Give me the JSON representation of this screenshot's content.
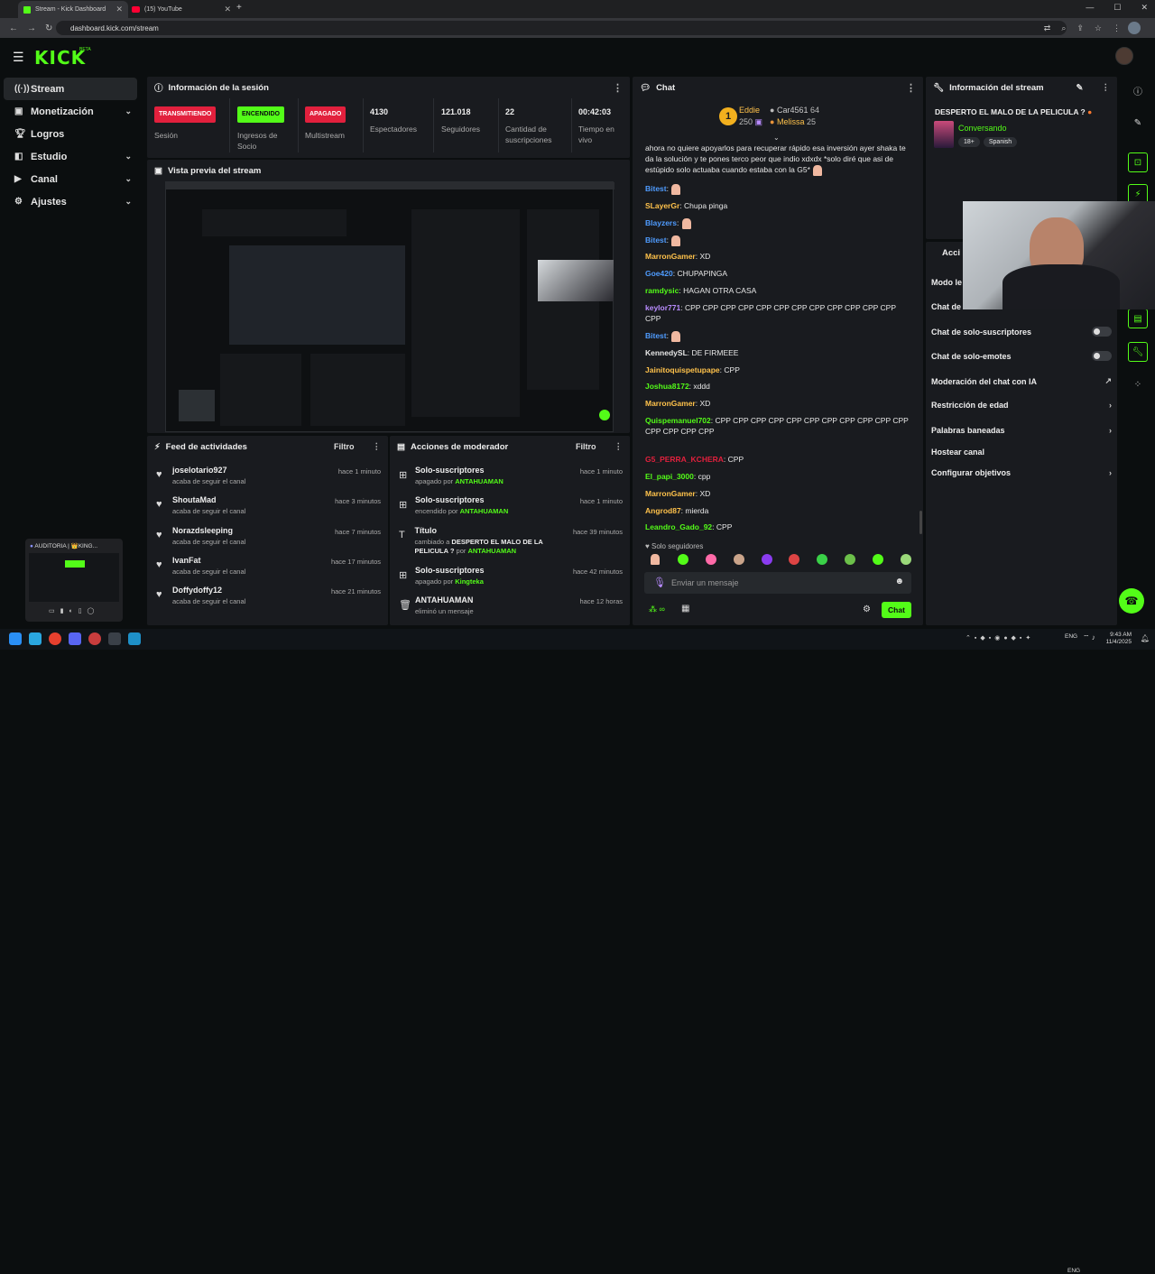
{
  "browser": {
    "tabs": [
      {
        "title": "Stream - Kick Dashboard",
        "active": true
      },
      {
        "title": "(15) YouTube",
        "active": false
      }
    ],
    "url": "dashboard.kick.com/stream"
  },
  "header": {
    "logo": "KICK",
    "beta": "BETA"
  },
  "sidebar": {
    "items": [
      {
        "label": "Stream",
        "icon": "stream-icon",
        "active": true,
        "chevron": false
      },
      {
        "label": "Monetización",
        "icon": "wallet-icon",
        "chevron": true
      },
      {
        "label": "Logros",
        "icon": "trophy-icon",
        "chevron": false
      },
      {
        "label": "Estudio",
        "icon": "studio-icon",
        "chevron": true
      },
      {
        "label": "Canal",
        "icon": "channel-icon",
        "chevron": true
      },
      {
        "label": "Ajustes",
        "icon": "gear-icon",
        "chevron": true
      }
    ]
  },
  "session": {
    "title": "Información de la sesión",
    "cols": [
      {
        "badge": "TRANSMITIENDO",
        "label": "Sesión",
        "kind": "red"
      },
      {
        "badge": "ENCENDIDO",
        "label": "Ingresos de Socio",
        "kind": "green"
      },
      {
        "badge": "APAGADO",
        "label": "Multistream",
        "kind": "red"
      },
      {
        "value": "4130",
        "label": "Espectadores"
      },
      {
        "value": "121.018",
        "label": "Seguidores"
      },
      {
        "value": "22",
        "label": "Cantidad de suscripciones"
      },
      {
        "value": "00:42:03",
        "label": "Tiempo en vivo"
      }
    ]
  },
  "preview": {
    "title": "Vista previa del stream"
  },
  "feed": {
    "title": "Feed de actividades",
    "filter": "Filtro",
    "items": [
      {
        "name": "joselotario927",
        "sub": "acaba de seguir el canal",
        "time": "hace 1 minuto"
      },
      {
        "name": "ShoutaMad",
        "sub": "acaba de seguir el canal",
        "time": "hace 3 minutos"
      },
      {
        "name": "Norazdsleeping",
        "sub": "acaba de seguir el canal",
        "time": "hace 7 minutos"
      },
      {
        "name": "IvanFat",
        "sub": "acaba de seguir el canal",
        "time": "hace 17 minutos"
      },
      {
        "name": "Doffydoffy12",
        "sub": "acaba de seguir el canal",
        "time": "hace 21 minutos"
      }
    ]
  },
  "mod": {
    "title": "Acciones de moderador",
    "filter": "Filtro",
    "items": [
      {
        "name": "Solo-suscriptores",
        "sub": "apagado por",
        "who": "ANTAHUAMAN",
        "time": "hace 1 minuto"
      },
      {
        "name": "Solo-suscriptores",
        "sub": "encendido por",
        "who": "ANTAHUAMAN",
        "time": "hace 1 minuto"
      },
      {
        "name": "Título",
        "sub": "cambiado a",
        "extra": "DESPERTO EL MALO DE LA PELICULA ?",
        "by": "por",
        "who": "ANTAHUAMAN",
        "time": "hace 39 minutos"
      },
      {
        "name": "Solo-suscriptores",
        "sub": "apagado por",
        "who": "Kingteka",
        "time": "hace 42 minutos"
      },
      {
        "name": "ANTAHUAMAN",
        "sub": "eliminó un mensaje",
        "time": "hace 12 horas"
      }
    ]
  },
  "chat": {
    "title": "Chat",
    "pinned": {
      "rank": "1",
      "first": "Eddie",
      "first_count": "250",
      "second": "Car4561",
      "second_count": "64",
      "third": "Melissa",
      "third_count": "25"
    },
    "messages": [
      {
        "user": "",
        "text": "ahora no quiere apoyarlos para recuperar rápido esa inversión ayer shaka te da la solución y te pones terco peor que indio xdxdx *solo diré que asi de estúpido solo actuaba cuando estaba con la G5*",
        "color": "#e8e8e8"
      },
      {
        "user": "Bitest",
        "text": "",
        "color": "#4f9cff"
      },
      {
        "user": "SLayerGr",
        "text": "Chupa pinga",
        "color": "#ffc24b"
      },
      {
        "user": "Blayzers",
        "text": "",
        "color": "#4f9cff"
      },
      {
        "user": "Bitest",
        "text": "",
        "color": "#4f9cff"
      },
      {
        "user": "MarronGamer",
        "text": "XD",
        "color": "#ffc24b"
      },
      {
        "user": "Goe420",
        "text": "CHUPAPINGA",
        "color": "#4f9cff"
      },
      {
        "user": "ramdysic",
        "text": "HAGAN OTRA CASA",
        "color": "#53fc18"
      },
      {
        "user": "keylor771",
        "text": "CPP  CPP  CPP  CPP  CPP  CPP  CPP  CPP  CPP  CPP  CPP  CPP  CPP",
        "color": "#b98cff"
      },
      {
        "user": "Bitest",
        "text": "",
        "color": "#4f9cff"
      },
      {
        "user": "KennedySL",
        "text": "DE FIRMEEE",
        "color": "#e8e8e8"
      },
      {
        "user": "Jainitoquispetupape",
        "text": "CPP",
        "color": "#ffc24b"
      },
      {
        "user": "Joshua8172",
        "text": "xddd",
        "color": "#53fc18"
      },
      {
        "user": "MarronGamer",
        "text": "XD",
        "color": "#ffc24b"
      },
      {
        "user": "Quispemanuel702",
        "text": "CPP  CPP  CPP  CPP  CPP  CPP  CPP  CPP  CPP  CPP  CPP  CPP  CPP  CPP  CPP",
        "color": "#53fc18"
      },
      {
        "user": "G5_PERRA_KCHERA",
        "text": "CPP",
        "color": "#e2203d"
      },
      {
        "user": "El_papi_3000",
        "text": "cpp",
        "color": "#53fc18"
      },
      {
        "user": "MarronGamer",
        "text": "XD",
        "color": "#ffc24b"
      },
      {
        "user": "Angrod87",
        "text": "mierda",
        "color": "#ffc24b"
      },
      {
        "user": "Leandro_Gado_92",
        "text": "CPP",
        "color": "#53fc18"
      }
    ],
    "followers_only": "Solo seguidores",
    "input_placeholder": "Enviar un mensaje",
    "send": "Chat"
  },
  "stream_info": {
    "title": "Información del stream",
    "stream_title": "DESPERTO EL MALO DE LA PELICULA ?",
    "category": "Conversando",
    "tags": [
      "18+",
      "Spanish"
    ]
  },
  "actions": {
    "title": "Acci",
    "rows": [
      {
        "label": "Modo le",
        "toggle": false,
        "chev": false
      },
      {
        "label": "Chat de",
        "toggle": false,
        "chev": false
      },
      {
        "label": "Chat de solo-suscriptores",
        "toggle": true,
        "chev": false
      },
      {
        "label": "Chat de solo-emotes",
        "toggle": true,
        "chev": false
      },
      {
        "label": "Moderación del chat con IA",
        "toggle": false,
        "ext": true
      },
      {
        "label": "Restricción de edad",
        "toggle": false,
        "chev": true
      },
      {
        "label": "Palabras baneadas",
        "toggle": false,
        "chev": true
      },
      {
        "label": "Hostear canal",
        "toggle": false,
        "chev": false
      },
      {
        "label": "Configurar objetivos",
        "toggle": false,
        "chev": true
      }
    ]
  },
  "mini_window": {
    "title": "AUDITORIA | 👑KING..."
  },
  "clock": {
    "time": "9:43 AM",
    "date": "11/4/2025",
    "lang": "ENG"
  },
  "colors": {
    "accent": "#53fc18",
    "danger": "#e2203d",
    "panel": "#191b1f",
    "bg": "#0b0e0f"
  }
}
